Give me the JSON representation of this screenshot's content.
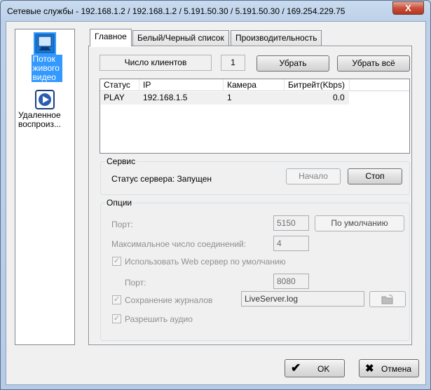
{
  "window": {
    "title": "Сетевые службы - 192.168.1.2 / 192.168.1.2 / 5.191.50.30 / 5.191.50.30 / 169.254.229.75",
    "close_label": "X"
  },
  "sidebar": {
    "items": [
      {
        "label_lines": [
          "Поток",
          "живого",
          "видео"
        ],
        "icon": "monitor-icon",
        "selected": true
      },
      {
        "label_lines": [
          "Удаленное",
          "воспроиз..."
        ],
        "icon": "playback-icon",
        "selected": false
      }
    ]
  },
  "tabs": [
    {
      "label": "Главное",
      "active": true
    },
    {
      "label": "Белый/Черный  список",
      "active": false
    },
    {
      "label": "Производительность",
      "active": false
    }
  ],
  "clients": {
    "count_label": "Число клиентов",
    "count_value": "1",
    "remove_label": "Убрать",
    "remove_all_label": "Убрать всё"
  },
  "table": {
    "columns": [
      "Статус",
      "IP",
      "Камера",
      "Битрейт(Kbps)"
    ],
    "rows": [
      [
        "PLAY",
        "192.168.1.5",
        "1",
        "0.0"
      ]
    ]
  },
  "service": {
    "group_title": "Сервис",
    "status_text": "Статус сервера: Запущен",
    "start_label": "Начало",
    "stop_label": "Стоп"
  },
  "options": {
    "group_title": "Опции",
    "port_label": "Порт:",
    "port_value": "5150",
    "default_label": "По умолчанию",
    "max_conn_label": "Максимальное число соединений:",
    "max_conn_value": "4",
    "web_server_label": "Использовать Web сервер по умолчанию",
    "web_port_label": "Порт:",
    "web_port_value": "8080",
    "save_logs_label": "Сохранение журналов",
    "log_file_value": "LiveServer.log",
    "allow_audio_label": "Разрешить аудио",
    "checked_mark": "✓"
  },
  "footer": {
    "ok_label": "OK",
    "cancel_label": "Отмена",
    "ok_icon": "✔",
    "cancel_icon": "✖"
  }
}
